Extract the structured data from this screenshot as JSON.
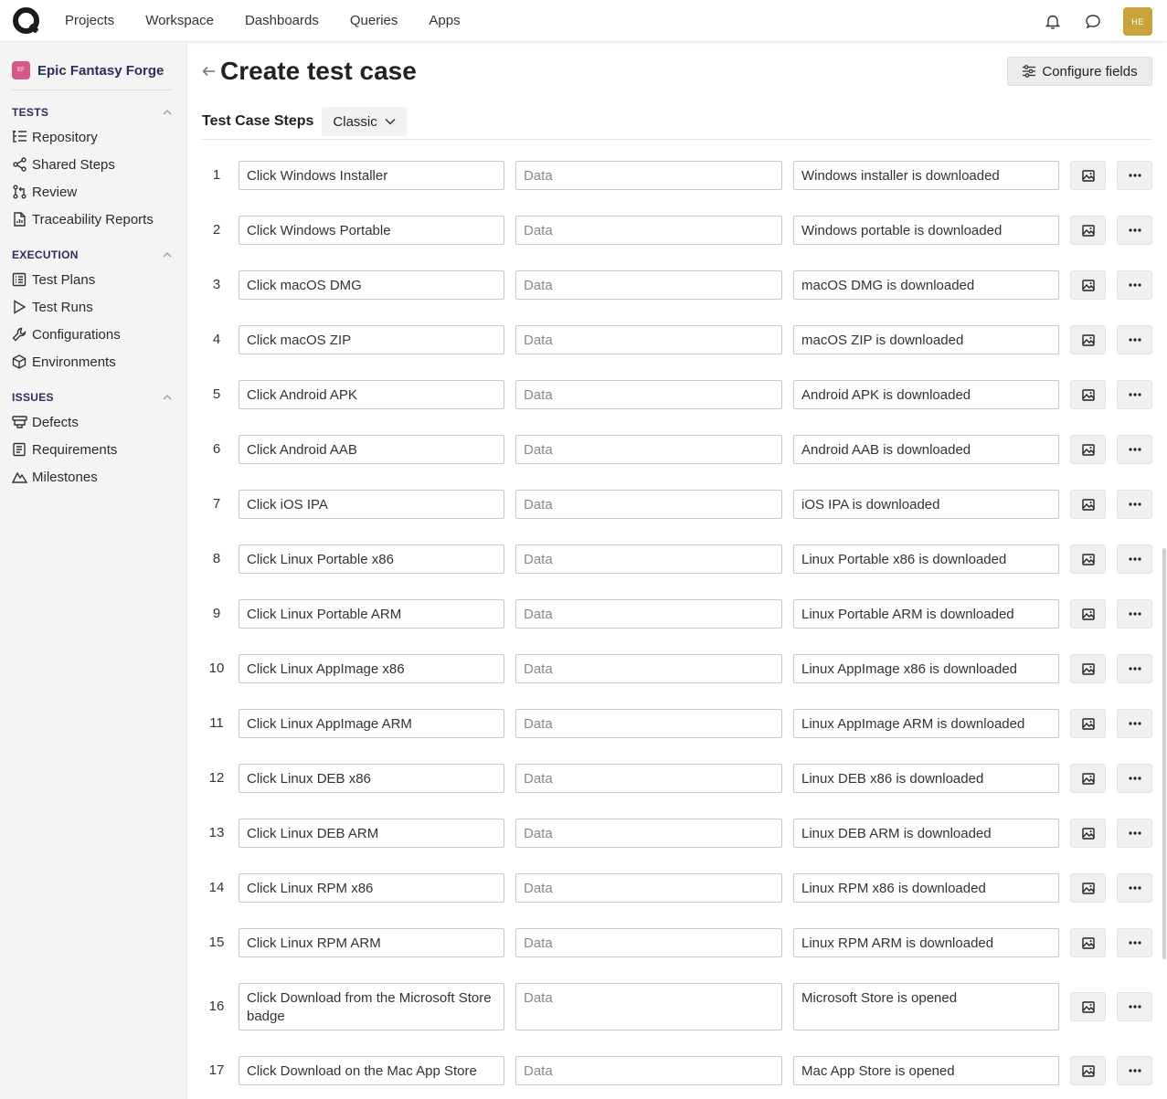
{
  "nav": {
    "items": [
      "Projects",
      "Workspace",
      "Dashboards",
      "Queries",
      "Apps"
    ],
    "avatar_initials": "HE"
  },
  "sidebar": {
    "project_badge": "EF",
    "project_name": "Epic Fantasy Forge",
    "sections": [
      {
        "title": "TESTS",
        "items": [
          {
            "label": "Repository",
            "icon": "repository-icon"
          },
          {
            "label": "Shared Steps",
            "icon": "shared-steps-icon"
          },
          {
            "label": "Review",
            "icon": "review-icon"
          },
          {
            "label": "Traceability Reports",
            "icon": "traceability-icon"
          }
        ]
      },
      {
        "title": "EXECUTION",
        "items": [
          {
            "label": "Test Plans",
            "icon": "test-plans-icon"
          },
          {
            "label": "Test Runs",
            "icon": "test-runs-icon"
          },
          {
            "label": "Configurations",
            "icon": "wrench-icon"
          },
          {
            "label": "Environments",
            "icon": "cube-icon"
          }
        ]
      },
      {
        "title": "ISSUES",
        "items": [
          {
            "label": "Defects",
            "icon": "defects-icon"
          },
          {
            "label": "Requirements",
            "icon": "requirements-icon"
          },
          {
            "label": "Milestones",
            "icon": "milestones-icon"
          }
        ]
      }
    ]
  },
  "main": {
    "title": "Create test case",
    "configure_label": "Configure fields",
    "steps_title": "Test Case Steps",
    "mode": "Classic",
    "data_placeholder": "Data",
    "steps": [
      {
        "n": "1",
        "action": "Click Windows Installer",
        "result": "Windows installer is downloaded"
      },
      {
        "n": "2",
        "action": "Click Windows Portable",
        "result": "Windows portable is downloaded"
      },
      {
        "n": "3",
        "action": "Click macOS DMG",
        "result": "macOS DMG is downloaded"
      },
      {
        "n": "4",
        "action": "Click macOS ZIP",
        "result": "macOS ZIP is downloaded"
      },
      {
        "n": "5",
        "action": "Click Android APK",
        "result": "Android APK is downloaded"
      },
      {
        "n": "6",
        "action": "Click Android AAB",
        "result": "Android AAB is downloaded"
      },
      {
        "n": "7",
        "action": "Click iOS IPA",
        "result": "iOS IPA is downloaded"
      },
      {
        "n": "8",
        "action": "Click Linux Portable x86",
        "result": "Linux Portable x86 is downloaded"
      },
      {
        "n": "9",
        "action": "Click Linux Portable ARM",
        "result": "Linux Portable ARM is downloaded"
      },
      {
        "n": "10",
        "action": "Click Linux AppImage x86",
        "result": "Linux AppImage x86 is downloaded"
      },
      {
        "n": "11",
        "action": "Click Linux AppImage ARM",
        "result": "Linux AppImage ARM is downloaded"
      },
      {
        "n": "12",
        "action": "Click Linux DEB x86",
        "result": "Linux DEB x86 is downloaded"
      },
      {
        "n": "13",
        "action": "Click Linux DEB ARM",
        "result": "Linux DEB ARM is downloaded"
      },
      {
        "n": "14",
        "action": "Click Linux RPM x86",
        "result": "Linux RPM x86 is downloaded"
      },
      {
        "n": "15",
        "action": "Click Linux RPM ARM",
        "result": "Linux RPM ARM is downloaded"
      },
      {
        "n": "16",
        "action": "Click Download from the Microsoft Store badge",
        "result": "Microsoft Store is opened"
      },
      {
        "n": "17",
        "action": "Click Download on the Mac App Store",
        "result": "Mac App Store is opened"
      }
    ]
  }
}
